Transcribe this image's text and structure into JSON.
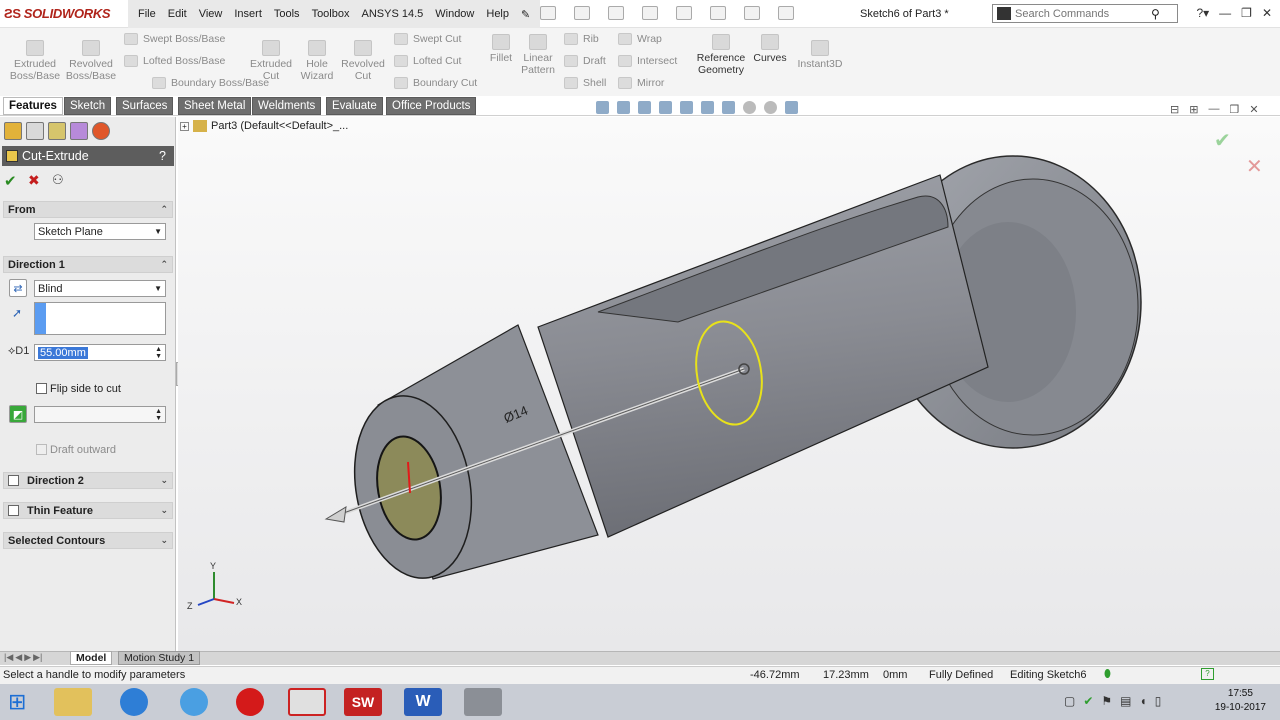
{
  "app": {
    "name": "SOLIDWORKS",
    "document_title": "Sketch6 of Part3 *"
  },
  "menu": [
    "File",
    "Edit",
    "View",
    "Insert",
    "Tools",
    "Toolbox",
    "ANSYS 14.5",
    "Window",
    "Help"
  ],
  "search": {
    "placeholder": "Search Commands"
  },
  "toolbar": {
    "extruded_boss": "Extruded\nBoss/Base",
    "revolved_boss": "Revolved\nBoss/Base",
    "swept_boss": "Swept Boss/Base",
    "lofted_boss": "Lofted Boss/Base",
    "boundary_boss": "Boundary Boss/Base",
    "extruded_cut": "Extruded\nCut",
    "hole_wizard": "Hole\nWizard",
    "revolved_cut": "Revolved\nCut",
    "swept_cut": "Swept Cut",
    "lofted_cut": "Lofted Cut",
    "boundary_cut": "Boundary Cut",
    "fillet": "Fillet",
    "linear_pattern": "Linear\nPattern",
    "rib": "Rib",
    "draft": "Draft",
    "shell": "Shell",
    "wrap": "Wrap",
    "intersect": "Intersect",
    "mirror": "Mirror",
    "reference_geometry": "Reference\nGeometry",
    "curves": "Curves",
    "instant3d": "Instant3D"
  },
  "tabs": [
    "Features",
    "Sketch",
    "Surfaces",
    "Sheet Metal",
    "Weldments",
    "Evaluate",
    "Office Products"
  ],
  "active_tab": "Features",
  "property_manager": {
    "title": "Cut-Extrude",
    "help": "?",
    "from": {
      "label": "From",
      "value": "Sketch Plane"
    },
    "direction1": {
      "label": "Direction 1",
      "end_condition": "Blind",
      "depth": "55.00mm",
      "flip_label": "Flip side to cut",
      "flip_checked": false,
      "draft_outward": "Draft outward"
    },
    "direction2": {
      "label": "Direction 2",
      "checked": false
    },
    "thin_feature": {
      "label": "Thin Feature",
      "checked": false
    },
    "selected_contours": {
      "label": "Selected Contours"
    }
  },
  "tree": {
    "root": "Part3  (Default<<Default>_..."
  },
  "model": {
    "dimension_label": "Ø14"
  },
  "bottom_tabs": [
    "Model",
    "Motion Study 1"
  ],
  "status": {
    "message": "Select a handle to modify parameters",
    "x": "-46.72mm",
    "y": "17.23mm",
    "z": "0mm",
    "state": "Fully Defined",
    "editing": "Editing Sketch6"
  },
  "clock": {
    "time": "17:55",
    "date": "19-10-2017"
  },
  "colors": {
    "accent_red": "#b0241b",
    "panel_header": "#5d5d5d",
    "part_body": "#8e9097",
    "sketch_circle": "#e8e21a"
  }
}
